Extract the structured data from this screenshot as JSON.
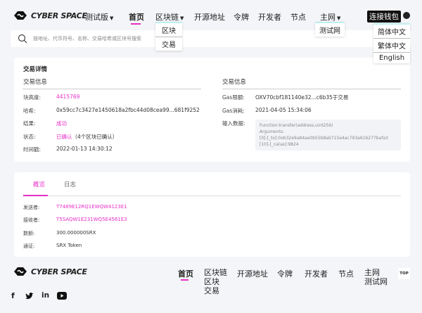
{
  "header": {
    "brand": "CYBER SPACE",
    "version": "测试版",
    "nav": [
      "首页",
      "区块链",
      "开源地址",
      "令牌",
      "开发者",
      "节点",
      "主网"
    ],
    "connect": "连接钱包"
  },
  "blockchain_dropdown": [
    "区块",
    "交易"
  ],
  "mainnet_dropdown": [
    "测试网"
  ],
  "language_dropdown": [
    "简体中文",
    "繁体中文",
    "English"
  ],
  "search": {
    "placeholder": "按地址、代币符号、名称、交易哈希或区块号搜索"
  },
  "details": {
    "title": "交易详情",
    "left_heading": "交易信息",
    "right_heading": "交易信息",
    "left": [
      {
        "label": "块高度:",
        "value": "4415769",
        "pink": true
      },
      {
        "label": "哈希:",
        "value": "0x59cc7c3427e1450618a2fbc44d08cea99...681f9252"
      },
      {
        "label": "结果:",
        "value": "成功",
        "pink": true
      },
      {
        "label": "状态:",
        "value": "已确认",
        "extra": "（4个区块已确认）",
        "pink": true
      },
      {
        "label": "时间戳:",
        "value": "2022-01-13 14:30:12"
      }
    ],
    "right": [
      {
        "label": "Gas限额:",
        "value": "OXV70cbf181140e32...c6b35于交易"
      },
      {
        "label": "Gas消耗:",
        "value": "2021-04-05 15:34:06"
      },
      {
        "label": "输入数据:"
      }
    ],
    "input_data": [
      "Function:transfer(address,uint256)",
      "Arguments:",
      "[0]-[_to]:0xb32e9a84ae0b55b8ab715e4ac793a61b277bafa3",
      "[10]-[_calue]:9824"
    ]
  },
  "tabs": [
    "概览",
    "日志"
  ],
  "overview": [
    {
      "label": "发送者:",
      "value": "T7489E12RQ1EWQW4123E1",
      "pink": true
    },
    {
      "label": "接收者:",
      "value": "T5SAQW1E231WQ5E4561E3",
      "pink": true
    },
    {
      "label": "数额:",
      "value": "300.000000SRX"
    },
    {
      "label": "通证:",
      "value": "SRX Token"
    }
  ],
  "footer": {
    "brand": "CYBER SPACE",
    "nav": [
      "首页",
      "区块链",
      "开源地址",
      "令牌",
      "开发者",
      "节点",
      "主网"
    ],
    "sub_blockchain": [
      "区块",
      "交易"
    ],
    "sub_mainnet": [
      "测试网"
    ],
    "top": "TOP",
    "social": [
      "facebook-icon",
      "twitter-icon",
      "linkedin-icon",
      "youtube-icon"
    ]
  },
  "colors": {
    "accent": "#e62ec8",
    "background": "#f4f5f8"
  }
}
